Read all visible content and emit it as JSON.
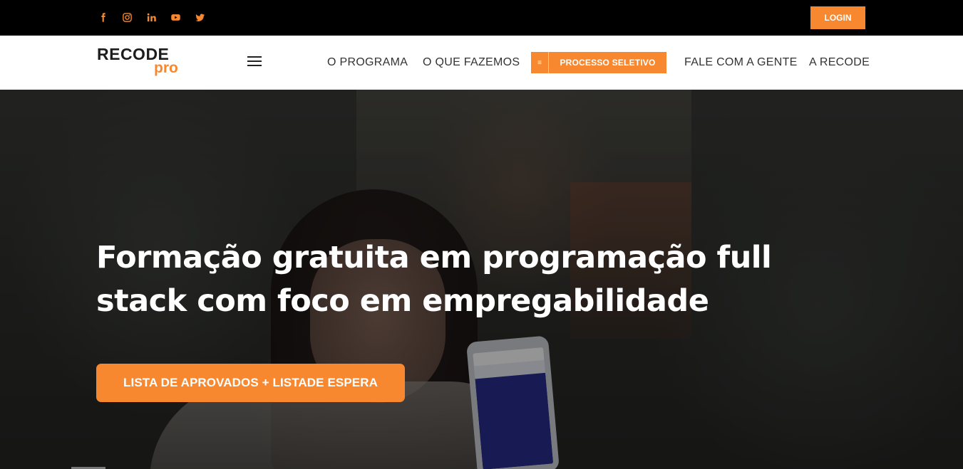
{
  "topbar": {
    "social": [
      {
        "icon": "facebook-icon",
        "color": "#f7882f"
      },
      {
        "icon": "instagram-icon",
        "color": "#f7882f"
      },
      {
        "icon": "linkedin-icon",
        "color": "#f7882f"
      },
      {
        "icon": "youtube-icon",
        "color": "#f7882f"
      },
      {
        "icon": "twitter-icon",
        "color": "#f7882f"
      }
    ],
    "login_label": "LOGIN"
  },
  "nav": {
    "logo_top": "RECODE",
    "logo_bottom": "pro",
    "items": [
      {
        "label": "O PROGRAMA"
      },
      {
        "label": "O QUE FAZEMOS"
      },
      {
        "label": "PROCESSO SELETIVO",
        "badge": "≡"
      },
      {
        "label": "FALE COM A GENTE"
      },
      {
        "label": "A RECODE"
      }
    ]
  },
  "hero": {
    "headline_line1": "Formação gratuita em programação full",
    "headline_line2": "stack com foco em empregabilidade",
    "cta_label": "LISTA DE APROVADOS + LISTADE ESPERA"
  },
  "colors": {
    "accent": "#f7882f",
    "topbar_bg": "#000000",
    "nav_bg": "#ffffff"
  }
}
